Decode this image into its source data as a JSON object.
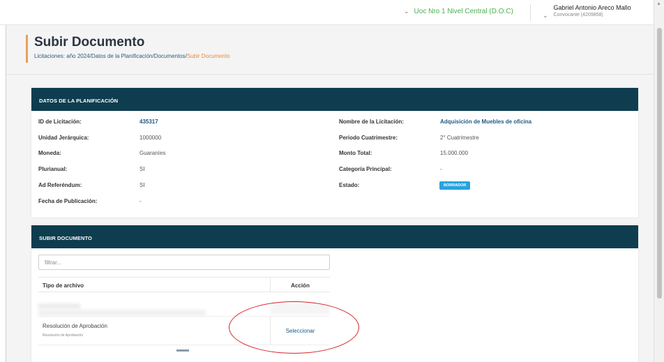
{
  "header": {
    "uoc": "Uoc Nro 1 Nivel Central (D.O.C)",
    "user_name": "Gabriel Antonio Areco Mallo",
    "user_role": "Convocante (4209858)"
  },
  "page": {
    "title": "Subir Documento",
    "breadcrumb": [
      {
        "label": "Licitaciones: año 2024"
      },
      {
        "label": "Datos de la Planificación"
      },
      {
        "label": "Documentos"
      },
      {
        "label": "Subir Documento"
      }
    ],
    "breadcrumb_sep": "/"
  },
  "planificacion": {
    "header": "DATOS DE LA PLANIFICACIÓN",
    "left": [
      {
        "label": "ID de Licitación:",
        "value": "435317"
      },
      {
        "label": "Unidad Jerárquica:",
        "value": "1000000"
      },
      {
        "label": "Moneda:",
        "value": "Guaraníes"
      },
      {
        "label": "Plurianual:",
        "value": "SI"
      },
      {
        "label": "Ad Referéndum:",
        "value": "SI"
      },
      {
        "label": "Fecha de Publicación:",
        "value": "-"
      }
    ],
    "right": [
      {
        "label": "Nombre de la Licitación:",
        "value": "Adquisición de Muebles de oficina"
      },
      {
        "label": "Periodo Cuatrimestre:",
        "value": "2° Cuatrimestre"
      },
      {
        "label": "Monto Total:",
        "value": "15.000.000"
      },
      {
        "label": "Categoría Principal:",
        "value": "-"
      },
      {
        "label": "Estado:",
        "value": "BORRADOR"
      }
    ]
  },
  "subir": {
    "header": "SUBIR DOCUMENTO",
    "filter_placeholder": "filtrar...",
    "columns": [
      "Tipo de archivo",
      "Acción"
    ],
    "rows": [
      {
        "name": "Resolución de Aprobación",
        "sub": "Resolución de Aprobación",
        "action": "Seleccionar"
      }
    ]
  },
  "colors": {
    "card_header": "#0d3d4f",
    "accent": "#e8a05a",
    "link": "#1c5a86",
    "badge": "#27a3e0",
    "annotation": "#d9232d",
    "uoc_text": "#4caf50"
  }
}
